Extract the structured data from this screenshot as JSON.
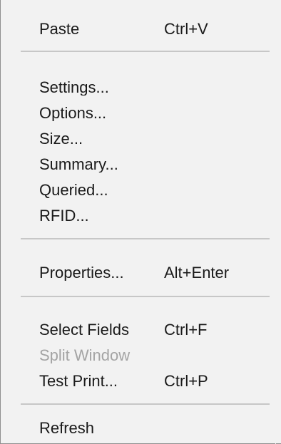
{
  "menu": {
    "items": [
      {
        "label": "Paste",
        "shortcut": "Ctrl+V",
        "enabled": true
      },
      {
        "label": "Settings...",
        "shortcut": "",
        "enabled": true
      },
      {
        "label": "Options...",
        "shortcut": "",
        "enabled": true
      },
      {
        "label": "Size...",
        "shortcut": "",
        "enabled": true
      },
      {
        "label": "Summary...",
        "shortcut": "",
        "enabled": true
      },
      {
        "label": "Queried...",
        "shortcut": "",
        "enabled": true
      },
      {
        "label": "RFID...",
        "shortcut": "",
        "enabled": true
      },
      {
        "label": "Properties...",
        "shortcut": "Alt+Enter",
        "enabled": true
      },
      {
        "label": "Select Fields",
        "shortcut": "Ctrl+F",
        "enabled": true
      },
      {
        "label": "Split Window",
        "shortcut": "",
        "enabled": false
      },
      {
        "label": "Test Print...",
        "shortcut": "Ctrl+P",
        "enabled": true
      },
      {
        "label": "Refresh",
        "shortcut": "",
        "enabled": true
      }
    ]
  },
  "colors": {
    "menu_background": "#f2f2f2",
    "text": "#1a1a1a",
    "disabled_text": "#a4a4a4",
    "separator": "#c7c7c7",
    "border": "#8f8f8f"
  }
}
